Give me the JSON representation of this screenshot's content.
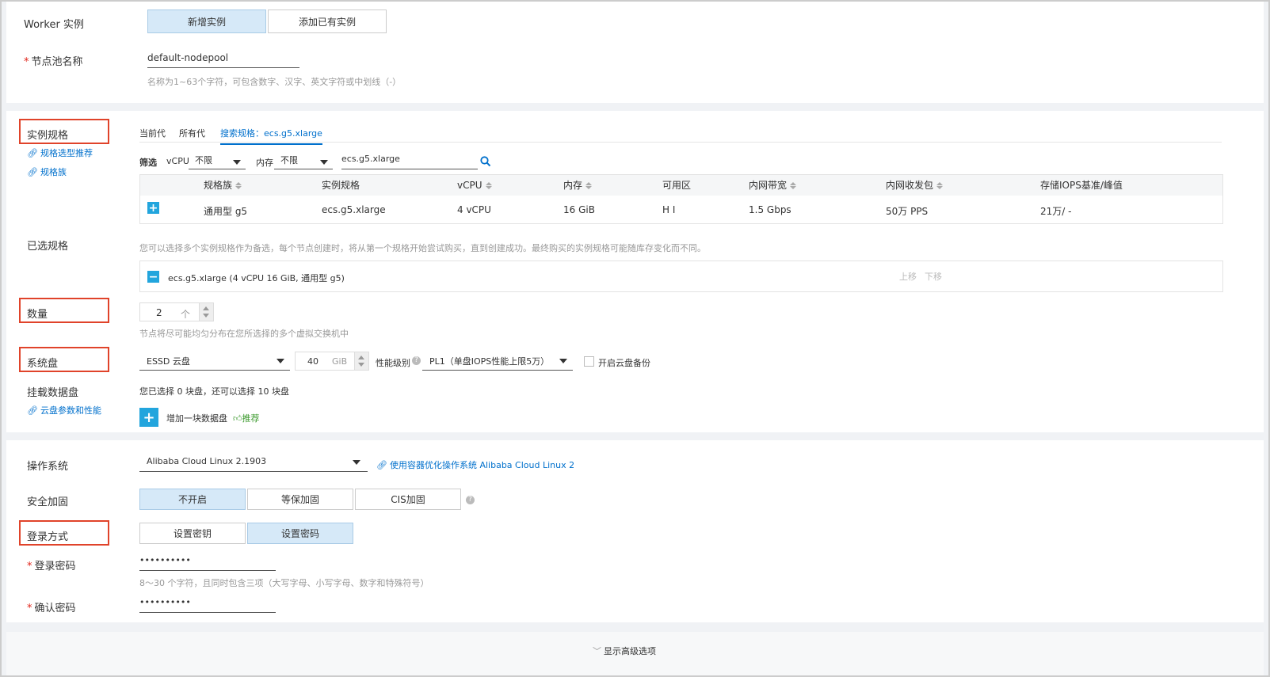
{
  "worker": {
    "label": "Worker 实例",
    "tabs": [
      "新增实例",
      "添加已有实例"
    ],
    "pool_name_label": "节点池名称",
    "pool_name_value": "default-nodepool",
    "pool_name_hint": "名称为1~63个字符，可包含数字、汉字、英文字符或中划线（-）"
  },
  "instance_spec": {
    "label": "实例规格",
    "links": [
      "规格选型推荐",
      "规格族"
    ],
    "tabs": [
      "当前代",
      "所有代",
      "搜索规格：ecs.g5.xlarge"
    ],
    "filter_label": "筛选",
    "vcpu_label": "vCPU",
    "vcpu_value": "不限",
    "mem_label": "内存",
    "mem_value": "不限",
    "search_value": "ecs.g5.xlarge",
    "columns": [
      "规格族",
      "实例规格",
      "vCPU",
      "内存",
      "可用区",
      "内网带宽",
      "内网收发包",
      "存储IOPS基准/峰值"
    ],
    "row": [
      "通用型 g5",
      "ecs.g5.xlarge",
      "4 vCPU",
      "16 GiB",
      "H I",
      "1.5 Gbps",
      "50万 PPS",
      "21万/ -"
    ]
  },
  "selected_spec": {
    "label": "已选规格",
    "hint": "您可以选择多个实例规格作为备选，每个节点创建时，将从第一个规格开始尝试购买，直到创建成功。最终购买的实例规格可能随库存变化而不同。",
    "item": "ecs.g5.xlarge (4 vCPU 16 GiB, 通用型 g5)",
    "move_up": "上移",
    "move_down": "下移"
  },
  "quantity": {
    "label": "数量",
    "value": "2",
    "unit": "个",
    "hint": "节点将尽可能均匀分布在您所选择的多个虚拟交换机中"
  },
  "system_disk": {
    "label": "系统盘",
    "type": "ESSD 云盘",
    "size": "40",
    "unit": "GiB",
    "perf_label": "性能级别",
    "perf_value": "PL1（单盘IOPS性能上限5万）",
    "backup_label": "开启云盘备份"
  },
  "data_disk": {
    "label": "挂载数据盘",
    "link": "云盘参数和性能",
    "info": "您已选择 0 块盘，还可以选择 10 块盘",
    "add_label": "增加一块数据盘",
    "recommend": "推荐"
  },
  "os": {
    "label": "操作系统",
    "value": "Alibaba Cloud Linux 2.1903",
    "link": "使用容器优化操作系统 Alibaba Cloud Linux 2"
  },
  "security": {
    "label": "安全加固",
    "options": [
      "不开启",
      "等保加固",
      "CIS加固"
    ]
  },
  "login": {
    "label": "登录方式",
    "options": [
      "设置密钥",
      "设置密码"
    ],
    "password_label": "登录密码",
    "password_value": "••••••••••",
    "password_hint": "8～30 个字符，且同时包含三项（大写字母、小写字母、数字和特殊符号）",
    "confirm_label": "确认密码",
    "confirm_value": "••••••••••"
  },
  "advanced": {
    "label": "显示高级选项"
  },
  "colors": {
    "accent": "#0070cc",
    "selected_bg": "#d6e9f8",
    "highlight_border": "#e0432a",
    "plus_bg": "#22a5dd",
    "recommend": "#3c9a2e"
  }
}
